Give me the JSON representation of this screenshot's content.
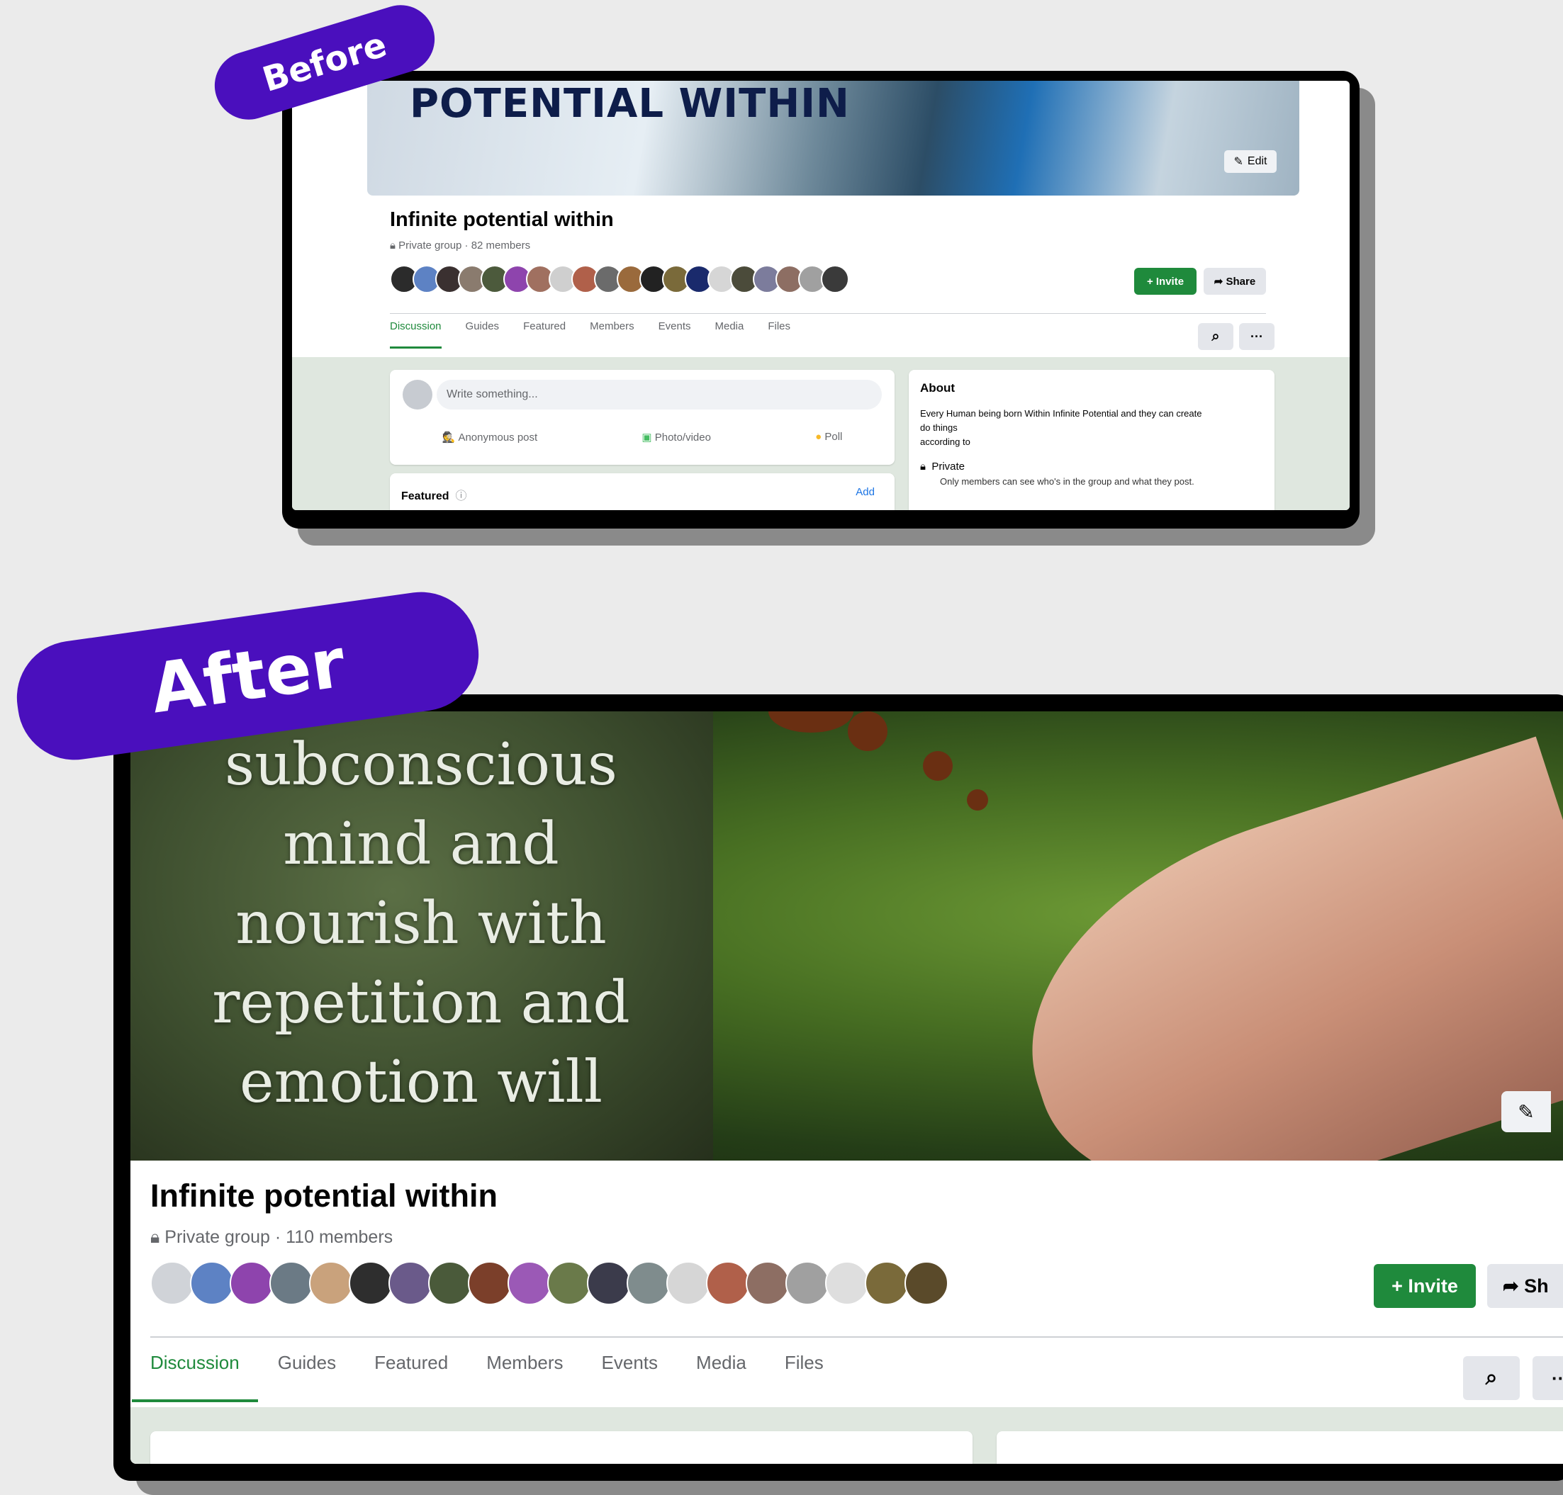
{
  "badges": {
    "before": "Before",
    "after": "After"
  },
  "before": {
    "cover_text": "POTENTIAL WITHIN",
    "edit_label": "Edit",
    "group_title": "Infinite potential within",
    "group_sub": "Private group · 82 members",
    "invite_label": "+ Invite",
    "share_label": "Share",
    "tabs": [
      "Discussion",
      "Guides",
      "Featured",
      "Members",
      "Events",
      "Media",
      "Files"
    ],
    "composer_placeholder": "Write something...",
    "composer_actions": [
      "Anonymous post",
      "Photo/video",
      "Poll"
    ],
    "featured_label": "Featured",
    "featured_add": "Add",
    "about_title": "About",
    "about_desc_1": "Every Human being born Within Infinite Potential and they can create",
    "about_desc_2": "do things",
    "about_desc_3": "according to",
    "privacy_title": "Private",
    "privacy_desc": "Only members can see who's in the group and what they post.",
    "avatar_colors": [
      "#2b2b2b",
      "#5d82c4",
      "#3a3030",
      "#8a7b6e",
      "#4c5a3c",
      "#8e44ad",
      "#a07060",
      "#cfcfcf",
      "#b0604a",
      "#6b6b6b",
      "#9a6a3c",
      "#222222",
      "#7a6a3a",
      "#1a2a6c",
      "#d6d6d6",
      "#4b4b3a",
      "#7c7c9c",
      "#8d6e63",
      "#a0a0a0",
      "#3a3a3a"
    ]
  },
  "after": {
    "quote_lines": [
      "subconscious",
      "mind and",
      "nourish with",
      "repetition and",
      "emotion will"
    ],
    "group_title": "Infinite potential within",
    "group_sub": "Private group · 110 members",
    "invite_label": "+ Invite",
    "share_label": "Sh",
    "tabs": [
      "Discussion",
      "Guides",
      "Featured",
      "Members",
      "Events",
      "Media",
      "Files"
    ],
    "avatar_colors": [
      "#d0d3d8",
      "#5d82c4",
      "#8e44ad",
      "#6b7a85",
      "#c9a27c",
      "#2e2e2e",
      "#6a5a8a",
      "#4a5a3a",
      "#7b3f2a",
      "#9b59b6",
      "#6a7a4a",
      "#3b3b4b",
      "#7f8c8d",
      "#d6d6d6",
      "#b0604a",
      "#8d6e63",
      "#a0a0a0",
      "#dedede",
      "#7a6a3a",
      "#5a4a2a"
    ],
    "colors": {
      "brand_green": "#1f8a3c",
      "badge_purple": "#4a0fbd"
    }
  }
}
